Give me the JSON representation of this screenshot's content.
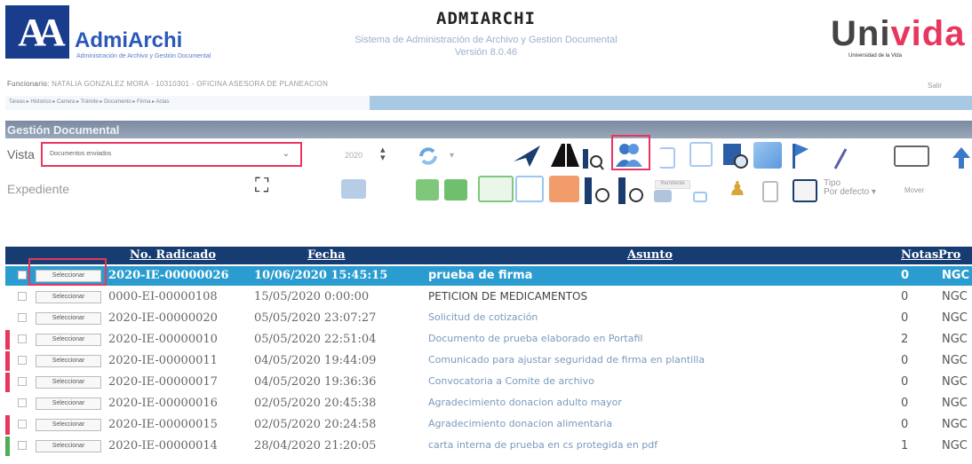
{
  "header": {
    "logo_text": "AdmiArchi",
    "logo_sub": "Administración de Archivo y Gestión Documental",
    "title": "ADMIARCHI",
    "subtitle": "Sistema de Administración de Archivo y Gestion Documental",
    "version": "Versión 8.0.46",
    "brand": "Uni",
    "brand_accent": "vida",
    "brand_tag": "Universidad de la Vida"
  },
  "user_bar": {
    "funcionario_label": "Funcionario:",
    "funcionario": "NATALIA GONZALEZ MORA - 10310301 - OFICINA ASESORA DE PLANEACION",
    "salir": "Salir",
    "breadcrumbs": "Tareas ▸ Historico ▸ Carrera ▸ Trámite ▸ Documento ▸ Firma ▸ Actas"
  },
  "section": {
    "title": "Gestión Documental"
  },
  "controls": {
    "vista_label": "Vista",
    "vista_value": "Documentos enviados",
    "year": "2020",
    "expediente_label": "Expediente",
    "tooltip": "Remitente",
    "tipo_label": "Tipo",
    "tipo_value": "Por defecto",
    "mover": "Mover"
  },
  "table": {
    "columns": [
      "No. Radicado",
      "Fecha",
      "Asunto",
      "Notas",
      "Pro"
    ],
    "select_label": "Seleccionar",
    "rows": [
      {
        "radicado": "2020-IE-00000026",
        "fecha": "10/06/2020 15:45:15",
        "asunto": "prueba de firma",
        "notas": "0",
        "pro": "NGC",
        "selected": true,
        "stripe": "#2b9cd0"
      },
      {
        "radicado": "0000-EI-00000108",
        "fecha": "15/05/2020 0:00:00",
        "asunto": "PETICION DE MEDICAMENTOS",
        "notas": "0",
        "pro": "NGC",
        "selected": false,
        "stripe": "#ffffff"
      },
      {
        "radicado": "2020-IE-00000020",
        "fecha": "05/05/2020 23:07:27",
        "asunto": "Solicitud de cotización",
        "notas": "0",
        "pro": "NGC",
        "selected": false,
        "stripe": "#ffffff"
      },
      {
        "radicado": "2020-IE-00000010",
        "fecha": "05/05/2020 22:51:04",
        "asunto": "Documento de prueba elaborado en Portafil",
        "notas": "2",
        "pro": "NGC",
        "selected": false,
        "stripe": "#e8365f"
      },
      {
        "radicado": "2020-IE-00000011",
        "fecha": "04/05/2020 19:44:09",
        "asunto": "Comunicado para ajustar seguridad de firma en plantilla",
        "notas": "0",
        "pro": "NGC",
        "selected": false,
        "stripe": "#e8365f"
      },
      {
        "radicado": "2020-IE-00000017",
        "fecha": "04/05/2020 19:36:36",
        "asunto": "Convocatoria a Comite de archivo",
        "notas": "0",
        "pro": "NGC",
        "selected": false,
        "stripe": "#e8365f"
      },
      {
        "radicado": "2020-IE-00000016",
        "fecha": "02/05/2020 20:45:38",
        "asunto": "Agradecimiento donacion adulto mayor",
        "notas": "0",
        "pro": "NGC",
        "selected": false,
        "stripe": "#ffffff"
      },
      {
        "radicado": "2020-IE-00000015",
        "fecha": "02/05/2020 20:24:58",
        "asunto": "Agradecimiento donacion alimentaria",
        "notas": "0",
        "pro": "NGC",
        "selected": false,
        "stripe": "#e8365f"
      },
      {
        "radicado": "2020-IE-00000014",
        "fecha": "28/04/2020 21:20:05",
        "asunto": "carta interna de prueba en cs protegida en pdf",
        "notas": "1",
        "pro": "NGC",
        "selected": false,
        "stripe": "#4caf50"
      }
    ]
  },
  "colors": {
    "accent": "#e8365f",
    "header_bg": "#163c72",
    "selected_row": "#2b9cd0"
  }
}
